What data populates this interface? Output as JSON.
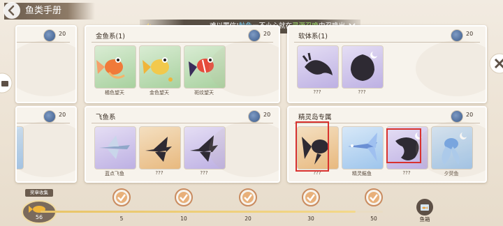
{
  "header": {
    "title": "鱼类手册"
  },
  "toast": {
    "prefix": "难以置信!",
    "fish": "魦鱼",
    "middle": "一不小心就在",
    "place": "灵源召唤",
    "suffix": "中召唤出"
  },
  "panels": {
    "top_left": {
      "count": "20"
    },
    "goldfish": {
      "title": "金鱼系(1)",
      "count": "20",
      "cards": [
        {
          "label": "橘色望天"
        },
        {
          "label": "金色望天"
        },
        {
          "label": "斑纹望天"
        }
      ]
    },
    "mollusc": {
      "title": "软体系(1)",
      "count": "20",
      "cards": [
        {
          "label": "???"
        },
        {
          "label": "???"
        }
      ]
    },
    "bottom_left": {
      "count": "20"
    },
    "flyingfish": {
      "title": "飞鱼系",
      "count": "20",
      "cards": [
        {
          "label": "蓝点飞鱼"
        },
        {
          "label": "???"
        },
        {
          "label": "???"
        }
      ]
    },
    "spirit_island": {
      "title": "精灵岛专属",
      "count": "20",
      "cards": [
        {
          "label": "???"
        },
        {
          "label": "精灵鳐鱼"
        },
        {
          "label": "???"
        },
        {
          "label": "夕荧鱼"
        }
      ]
    }
  },
  "collection": {
    "label": "奖章收集",
    "count": "56",
    "progress": 0.92,
    "milestones": [
      "5",
      "10",
      "20",
      "30",
      "50"
    ]
  },
  "fish_tank": {
    "label": "鱼箱"
  },
  "colors": {
    "highlight_blue": "#7fd6ff",
    "highlight_green": "#a5e36e",
    "red_box": "#d8322f"
  }
}
